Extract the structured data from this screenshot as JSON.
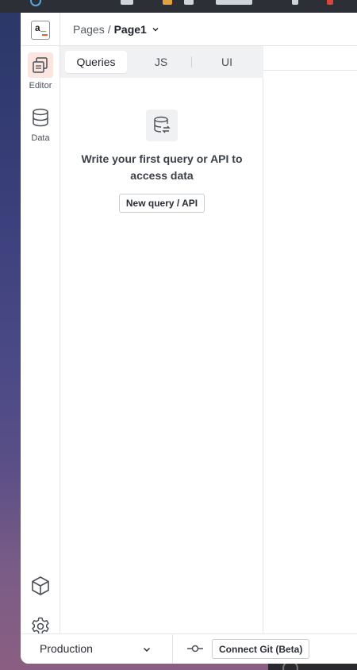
{
  "app": {
    "logo_text": "a_"
  },
  "header": {
    "breadcrumb_root": "Pages",
    "breadcrumb_separator": "/",
    "current_page": "Page1"
  },
  "sidebar": {
    "items": [
      {
        "label": "Editor",
        "icon": "editor-pages-icon",
        "active": true
      },
      {
        "label": "Data",
        "icon": "database-icon",
        "active": false
      }
    ],
    "bottom_icons": [
      "packages-cube-icon",
      "settings-gear-icon"
    ]
  },
  "explorer": {
    "tabs": [
      {
        "label": "Queries",
        "active": true
      },
      {
        "label": "JS",
        "active": false
      },
      {
        "label": "UI",
        "active": false
      }
    ],
    "empty_state": {
      "icon": "database-sync-icon",
      "message": "Write your first query or API to access data",
      "button_label": "New query / API"
    }
  },
  "bottom_bar": {
    "environment": "Production",
    "git_button_label": "Connect Git (Beta)"
  },
  "colors": {
    "accent": "#f0602a",
    "active_bg": "#fbe5de",
    "tab_bar_bg": "#f0f1f3"
  }
}
